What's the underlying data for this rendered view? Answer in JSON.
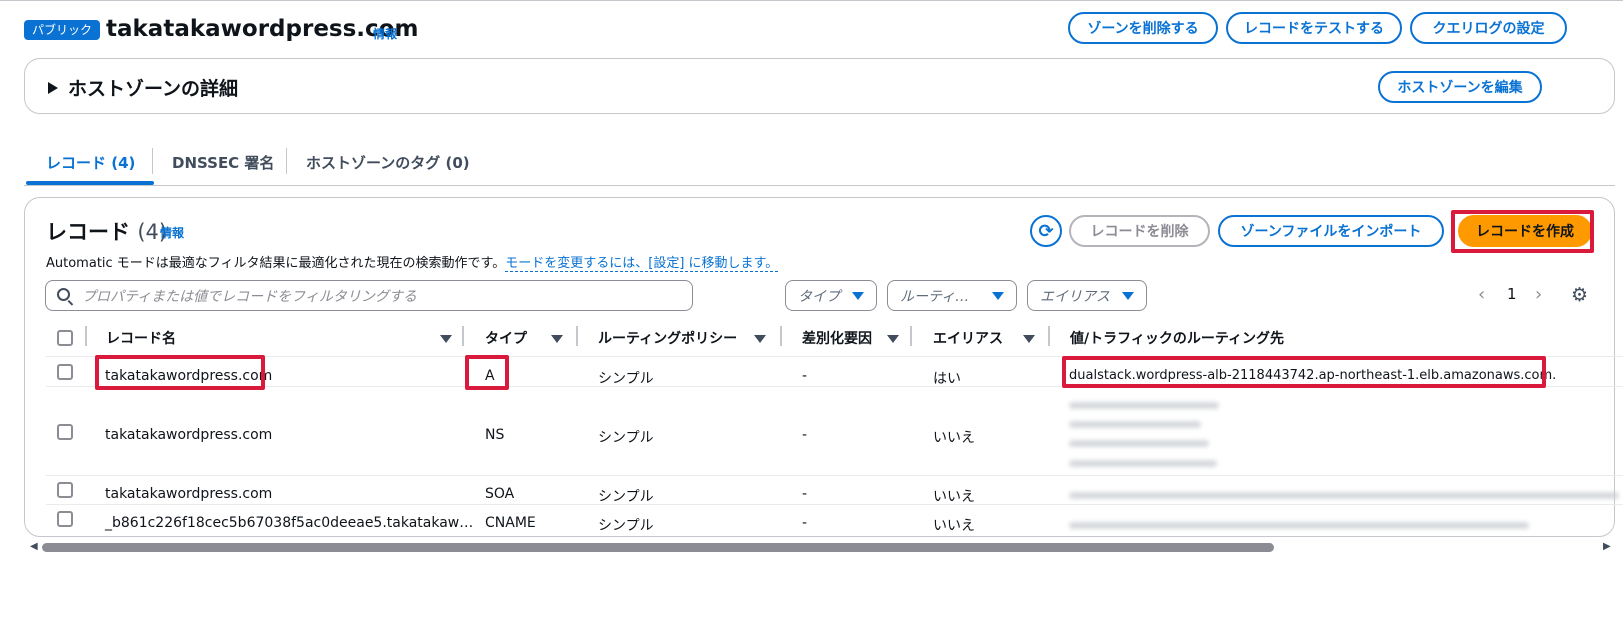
{
  "header": {
    "badge": "パブリック",
    "zone_name": "takatakawordpress.com",
    "info": "情報",
    "delete_zone": "ゾーンを削除する",
    "test_record": "レコードをテストする",
    "query_log": "クエリログの設定"
  },
  "details": {
    "title": "ホストゾーンの詳細",
    "edit": "ホストゾーンを編集"
  },
  "tabs": [
    {
      "label": "レコード (4)"
    },
    {
      "label": "DNSSEC 署名"
    },
    {
      "label": "ホストゾーンのタグ (0)"
    }
  ],
  "records": {
    "title": "レコード",
    "count": "(4)",
    "info": "情報",
    "refresh_icon": "refresh-icon",
    "delete": "レコードを削除",
    "import": "ゾーンファイルをインポート",
    "create": "レコードを作成",
    "auto_text": "Automatic モードは最適なフィルタ結果に最適化された現在の検索動作です。",
    "auto_link": "モードを変更するには、[設定] に移動します。",
    "search_placeholder": "プロパティまたは値でレコードをフィルタリングする",
    "filter_type": "タイプ",
    "filter_routing": "ルーティ…",
    "filter_alias": "エイリアス",
    "page": "1"
  },
  "columns": [
    "レコード名",
    "タイプ",
    "ルーティングポリシー",
    "差別化要因",
    "エイリアス",
    "値/トラフィックのルーティング先"
  ],
  "rows": [
    {
      "name": "takatakawordpress.com",
      "type": "A",
      "policy": "シンプル",
      "diff": "-",
      "alias": "はい",
      "value": "dualstack.wordpress-alb-2118443742.ap-northeast-1.elb.amazonaws.com."
    },
    {
      "name": "takatakawordpress.com",
      "type": "NS",
      "policy": "シンプル",
      "diff": "-",
      "alias": "いいえ",
      "value": ""
    },
    {
      "name": "takatakawordpress.com",
      "type": "SOA",
      "policy": "シンプル",
      "diff": "-",
      "alias": "いいえ",
      "value": ""
    },
    {
      "name": "_b861c226f18cec5b67038f5ac0deeae5.takatakaw…",
      "type": "CNAME",
      "policy": "シンプル",
      "diff": "-",
      "alias": "いいえ",
      "value": ""
    }
  ],
  "colors": {
    "accent": "#0972d3",
    "primary": "#ff9900",
    "highlight": "#d91a3c"
  }
}
